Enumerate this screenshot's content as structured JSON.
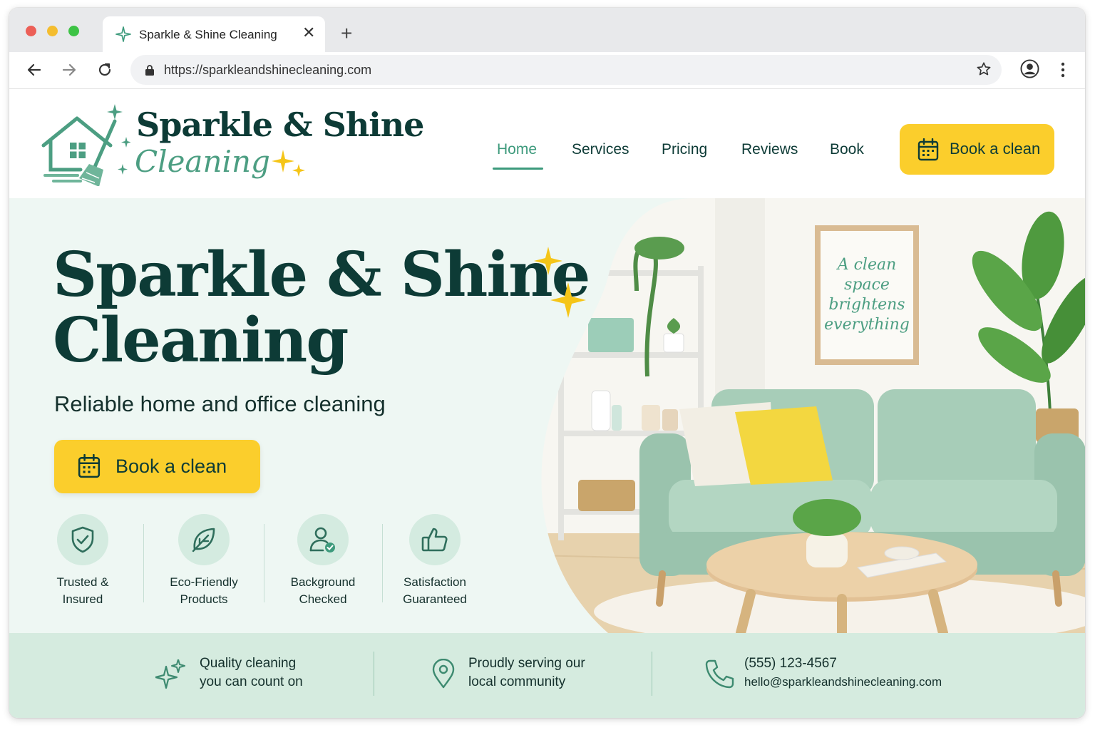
{
  "browser": {
    "tab_title": "Sparkle & Shine Cleaning",
    "tab_close": "✕",
    "new_tab": "+",
    "url": "https://sparkleandshinecleaning.com"
  },
  "header": {
    "logo_title": "Sparkle & Shine",
    "logo_subtitle": "Cleaning",
    "nav": [
      {
        "label": "Home",
        "active": true
      },
      {
        "label": "Services",
        "active": false
      },
      {
        "label": "Pricing",
        "active": false
      },
      {
        "label": "Reviews",
        "active": false
      },
      {
        "label": "Book",
        "active": false
      }
    ],
    "cta_label": "Book a clean"
  },
  "hero": {
    "title_line1": "Sparkle & Shine",
    "title_line2": "Cleaning",
    "subtitle": "Reliable home and office cleaning",
    "cta_label": "Book a clean",
    "poster_text": [
      "A clean",
      "space",
      "brightens",
      "everything"
    ],
    "badges": [
      {
        "icon": "shield-check-icon",
        "lines": [
          "Trusted &",
          "Insured"
        ]
      },
      {
        "icon": "leaf-icon",
        "lines": [
          "Eco-Friendly",
          "Products"
        ]
      },
      {
        "icon": "user-check-icon",
        "lines": [
          "Background",
          "Checked"
        ]
      },
      {
        "icon": "thumbs-up-icon",
        "lines": [
          "Satisfaction",
          "Guaranteed"
        ]
      }
    ]
  },
  "strip": [
    {
      "icon": "sparkle-icon",
      "lines": [
        "Quality cleaning",
        "you can count on"
      ]
    },
    {
      "icon": "location-pin-icon",
      "lines": [
        "Proudly serving our",
        "local community"
      ]
    },
    {
      "icon": "phone-icon",
      "lines": [
        "(555) 123-4567",
        "hello@sparkleandshinecleaning.com"
      ]
    }
  ],
  "colors": {
    "brand_dark": "#0d3b36",
    "brand_green": "#3d9a7c",
    "accent_yellow": "#fbce2c",
    "hero_bg": "#eef7f3",
    "strip_bg": "#d5ebdf"
  }
}
